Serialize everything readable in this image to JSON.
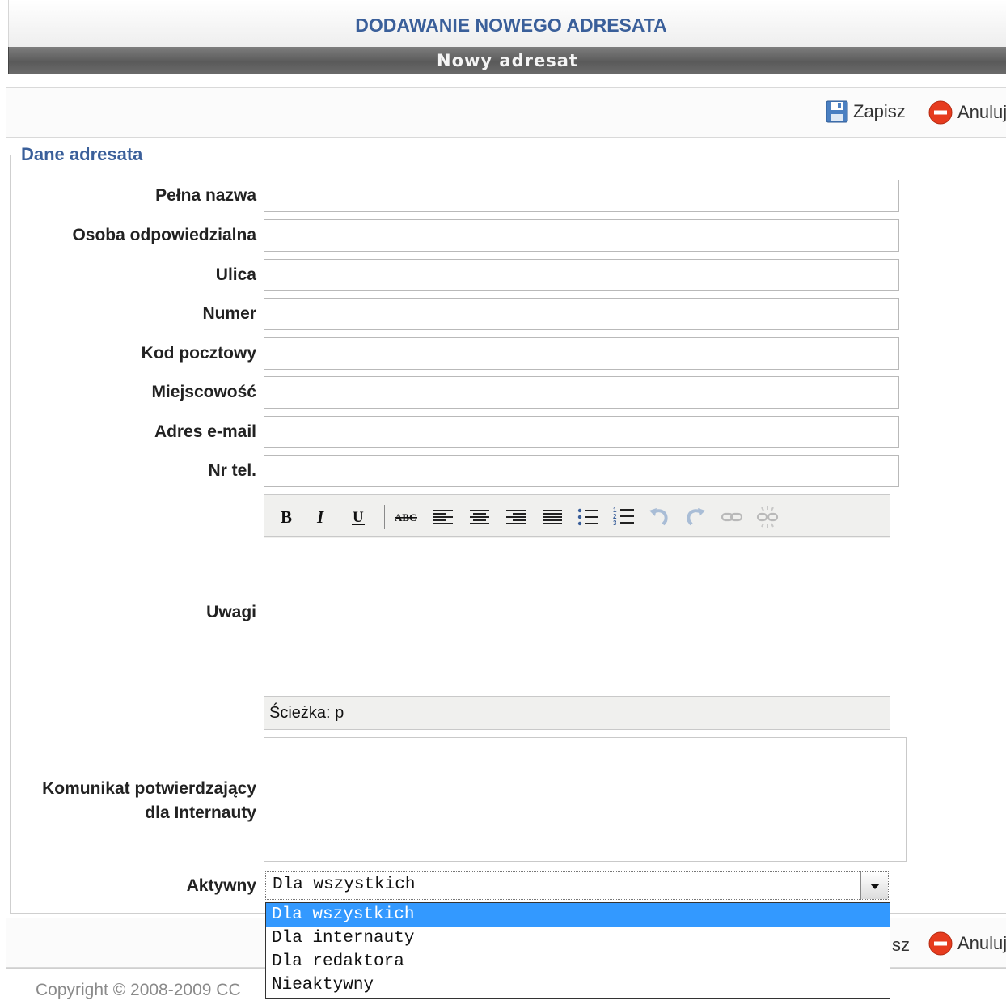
{
  "page_title": "DODAWANIE NOWEGO ADRESATA",
  "header_bar": "Nowy adresat",
  "toolbar": {
    "save_label": "Zapisz",
    "cancel_label": "Anuluj"
  },
  "bottom_toolbar": {
    "save_label_partial": "sz",
    "cancel_label": "Anuluj"
  },
  "fieldset_legend": "Dane adresata",
  "fields": [
    {
      "label": "Pełna nazwa",
      "value": ""
    },
    {
      "label": "Osoba odpowiedzialna",
      "value": ""
    },
    {
      "label": "Ulica",
      "value": ""
    },
    {
      "label": "Numer",
      "value": ""
    },
    {
      "label": "Kod pocztowy",
      "value": ""
    },
    {
      "label": "Miejscowość",
      "value": ""
    },
    {
      "label": "Adres e-mail",
      "value": ""
    },
    {
      "label": "Nr tel.",
      "value": ""
    }
  ],
  "notes": {
    "label": "Uwagi",
    "path_text": "Ścieżka: p"
  },
  "confirmation": {
    "label_line1": "Komunikat potwierdzający",
    "label_line2": "dla Internauty"
  },
  "active": {
    "label": "Aktywny",
    "selected": "Dla wszystkich",
    "options": [
      "Dla wszystkich",
      "Dla internauty",
      "Dla redaktora",
      "Nieaktywny"
    ]
  },
  "footer": {
    "copyright": "Copyright © 2008-2009 CC"
  },
  "colors": {
    "accent": "#3a5f9a",
    "cancel_red": "#e63b1e",
    "selected_option": "#3399ff"
  }
}
